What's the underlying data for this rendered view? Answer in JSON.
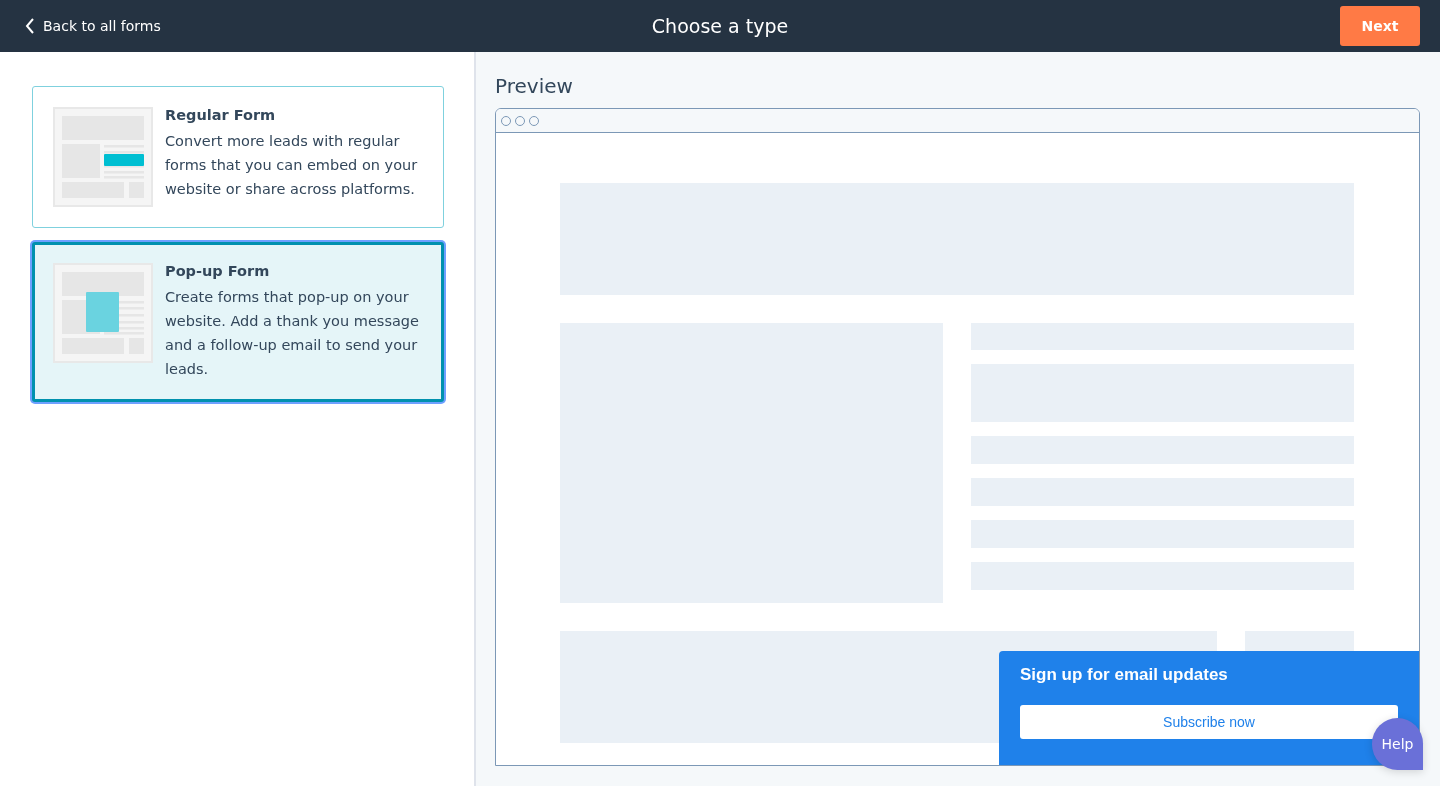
{
  "header": {
    "back_link": "Back to all forms",
    "title": "Choose a type",
    "next_button": "Next"
  },
  "form_types": [
    {
      "kind": "regular",
      "title": "Regular Form",
      "description": "Convert more leads with regular forms that you can embed on your website or share across platforms.",
      "selected": false
    },
    {
      "kind": "popup",
      "title": "Pop-up Form",
      "description": "Create forms that pop-up on your website. Add a thank you message and a follow-up email to send your leads.",
      "selected": true
    }
  ],
  "preview": {
    "title": "Preview",
    "popup": {
      "heading": "Sign up for email updates",
      "button": "Subscribe now"
    }
  },
  "help_button": "Help"
}
